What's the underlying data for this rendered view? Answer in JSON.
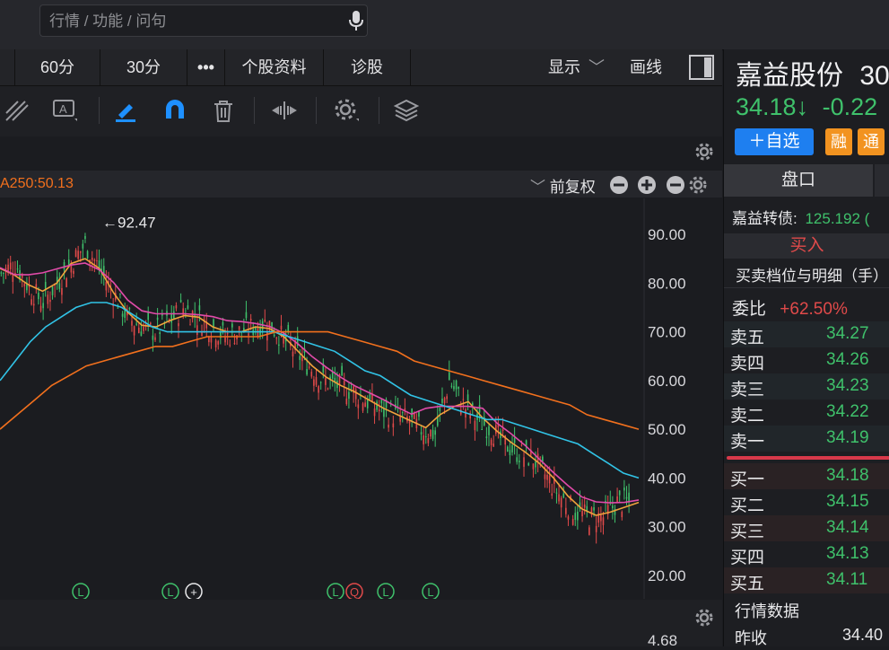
{
  "search": {
    "placeholder": "行情 / 功能 / 问句",
    "mic_icon": "microphone-icon"
  },
  "tabs": [
    {
      "label": "60分"
    },
    {
      "label": "30分"
    },
    {
      "label": "•••"
    },
    {
      "label": "个股资料"
    },
    {
      "label": "诊股"
    }
  ],
  "tabbar_right": {
    "display_label": "显示",
    "draw_label": "画线"
  },
  "toolbar": {
    "icons": [
      "fib-lines-icon",
      "text-annotation-icon",
      "highlighter-icon",
      "magnet-icon",
      "trash-icon",
      "measure-icon",
      "settings-icon",
      "layers-icon"
    ]
  },
  "info": {
    "ma250": "A250:50.13",
    "adjust": "前复权"
  },
  "chart_data": {
    "type": "line",
    "y_ticks": [
      "90.00",
      "80.00",
      "70.00",
      "60.00",
      "50.00",
      "40.00",
      "30.00",
      "20.00"
    ],
    "ylim": [
      20,
      90
    ],
    "peak_label": "←92.47",
    "peak_value": 92.47,
    "bottom_axis_value": "4.68",
    "markers": [
      "L",
      "L",
      "+",
      "L",
      "Q",
      "L",
      "L"
    ],
    "series": [
      {
        "color": "#31c3e6"
      },
      {
        "color": "#e14ba9"
      },
      {
        "color": "#f0a23c"
      },
      {
        "color": "#1fb7ee"
      },
      {
        "color": "#f2701d"
      }
    ],
    "ma_price": [
      82,
      84,
      79,
      76,
      80,
      84,
      88,
      83,
      78,
      73,
      71,
      70,
      72,
      75,
      73,
      71,
      69,
      70,
      71,
      72,
      69,
      66,
      63,
      60,
      59,
      58,
      56,
      54,
      53,
      52,
      50,
      49,
      60,
      55,
      52,
      50,
      47,
      45,
      44,
      40,
      36,
      33,
      32,
      32,
      35,
      35
    ],
    "ma_slow": [
      60,
      64,
      68,
      71,
      73,
      75,
      76,
      76,
      75,
      73,
      71,
      70,
      70,
      70,
      70,
      70,
      70,
      70,
      70,
      69,
      68,
      67,
      66,
      64,
      62,
      61,
      59,
      57,
      56,
      55,
      54,
      53,
      52,
      52,
      51,
      50,
      49,
      48,
      47,
      45,
      43,
      41,
      40
    ],
    "ma250": [
      50,
      53,
      56,
      59,
      61,
      63,
      64,
      65,
      66,
      67,
      67,
      68,
      69,
      69,
      69,
      69,
      70,
      70,
      70,
      70,
      69,
      68,
      67,
      66,
      64,
      63,
      62,
      61,
      60,
      59,
      58,
      57,
      56,
      55,
      53,
      52,
      51,
      50
    ]
  },
  "stock": {
    "name": "嘉益股份",
    "code_partial": "30",
    "price": "34.18↓",
    "change": "-0.22",
    "watch_btn": "＋自选",
    "badge1": "融",
    "badge2": "通",
    "tab_label": "盘口",
    "bond_label": "嘉益转债:",
    "bond_value": "125.192 (",
    "buy_label": "买入",
    "depth_title": "买卖档位与明细（手）",
    "wei_label": "委比",
    "wei_value": "+62.50%",
    "asks": [
      {
        "label": "卖五",
        "price": "34.27"
      },
      {
        "label": "卖四",
        "price": "34.26"
      },
      {
        "label": "卖三",
        "price": "34.23"
      },
      {
        "label": "卖二",
        "price": "34.22"
      },
      {
        "label": "卖一",
        "price": "34.19"
      }
    ],
    "bids": [
      {
        "label": "买一",
        "price": "34.18"
      },
      {
        "label": "买二",
        "price": "34.15"
      },
      {
        "label": "买三",
        "price": "34.14"
      },
      {
        "label": "买四",
        "price": "34.13"
      },
      {
        "label": "买五",
        "price": "34.11"
      }
    ],
    "market_title": "行情数据",
    "prev_close_label": "昨收",
    "prev_close_value": "34.40"
  }
}
